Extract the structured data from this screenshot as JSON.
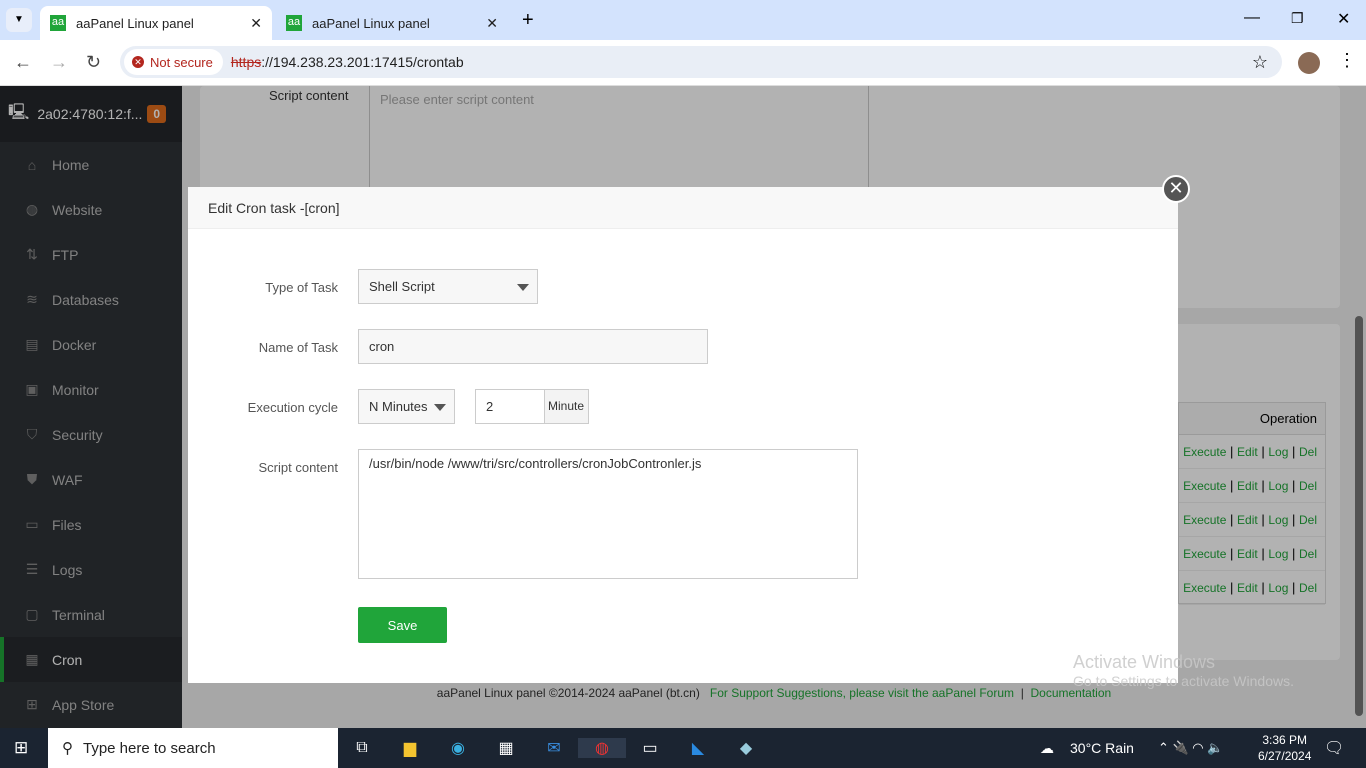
{
  "browser": {
    "tabs": [
      {
        "favicon": "aa",
        "title": "aaPanel Linux panel"
      },
      {
        "favicon": "aa",
        "title": "aaPanel Linux panel"
      }
    ],
    "security": "Not secure",
    "url_scheme": "https",
    "url_rest": "://194.238.23.201:17415/crontab"
  },
  "sidebar": {
    "server": "2a02:4780:12:f...",
    "badge": "0",
    "items": [
      {
        "label": "Home",
        "icon": "home-icon"
      },
      {
        "label": "Website",
        "icon": "globe-icon"
      },
      {
        "label": "FTP",
        "icon": "ftp-icon"
      },
      {
        "label": "Databases",
        "icon": "database-icon"
      },
      {
        "label": "Docker",
        "icon": "docker-icon"
      },
      {
        "label": "Monitor",
        "icon": "monitor-icon"
      },
      {
        "label": "Security",
        "icon": "shield-icon"
      },
      {
        "label": "WAF",
        "icon": "waf-icon"
      },
      {
        "label": "Files",
        "icon": "folder-icon"
      },
      {
        "label": "Logs",
        "icon": "logs-icon"
      },
      {
        "label": "Terminal",
        "icon": "terminal-icon"
      },
      {
        "label": "Cron",
        "icon": "calendar-icon"
      },
      {
        "label": "App Store",
        "icon": "apps-icon"
      }
    ]
  },
  "background": {
    "script_label": "Script content",
    "script_placeholder": "Please enter script content",
    "operation_header": "Operation",
    "row_ops": [
      "Execute",
      "Edit",
      "Log",
      "Del"
    ],
    "row_count": 5
  },
  "modal": {
    "title": "Edit Cron task -[cron]",
    "type_label": "Type of Task",
    "type_value": "Shell Script",
    "name_label": "Name of Task",
    "name_value": "cron",
    "cycle_label": "Execution cycle",
    "cycle_value": "N Minutes",
    "minute_value": "2",
    "minute_unit": "Minute",
    "script_label": "Script content",
    "script_value": "/usr/bin/node /www/tri/src/controllers/cronJobContronler.js",
    "save": "Save"
  },
  "footer": {
    "copyright": "aaPanel Linux panel ©2014-2024 aaPanel (bt.cn)",
    "support": "For Support Suggestions, please visit the aaPanel Forum",
    "docs": "Documentation"
  },
  "watermark": {
    "line1": "Activate Windows",
    "line2": "Go to Settings to activate Windows."
  },
  "taskbar": {
    "search": "Type here to search",
    "weather": "30°C  Rain",
    "time": "3:36 PM",
    "date": "6/27/2024"
  }
}
